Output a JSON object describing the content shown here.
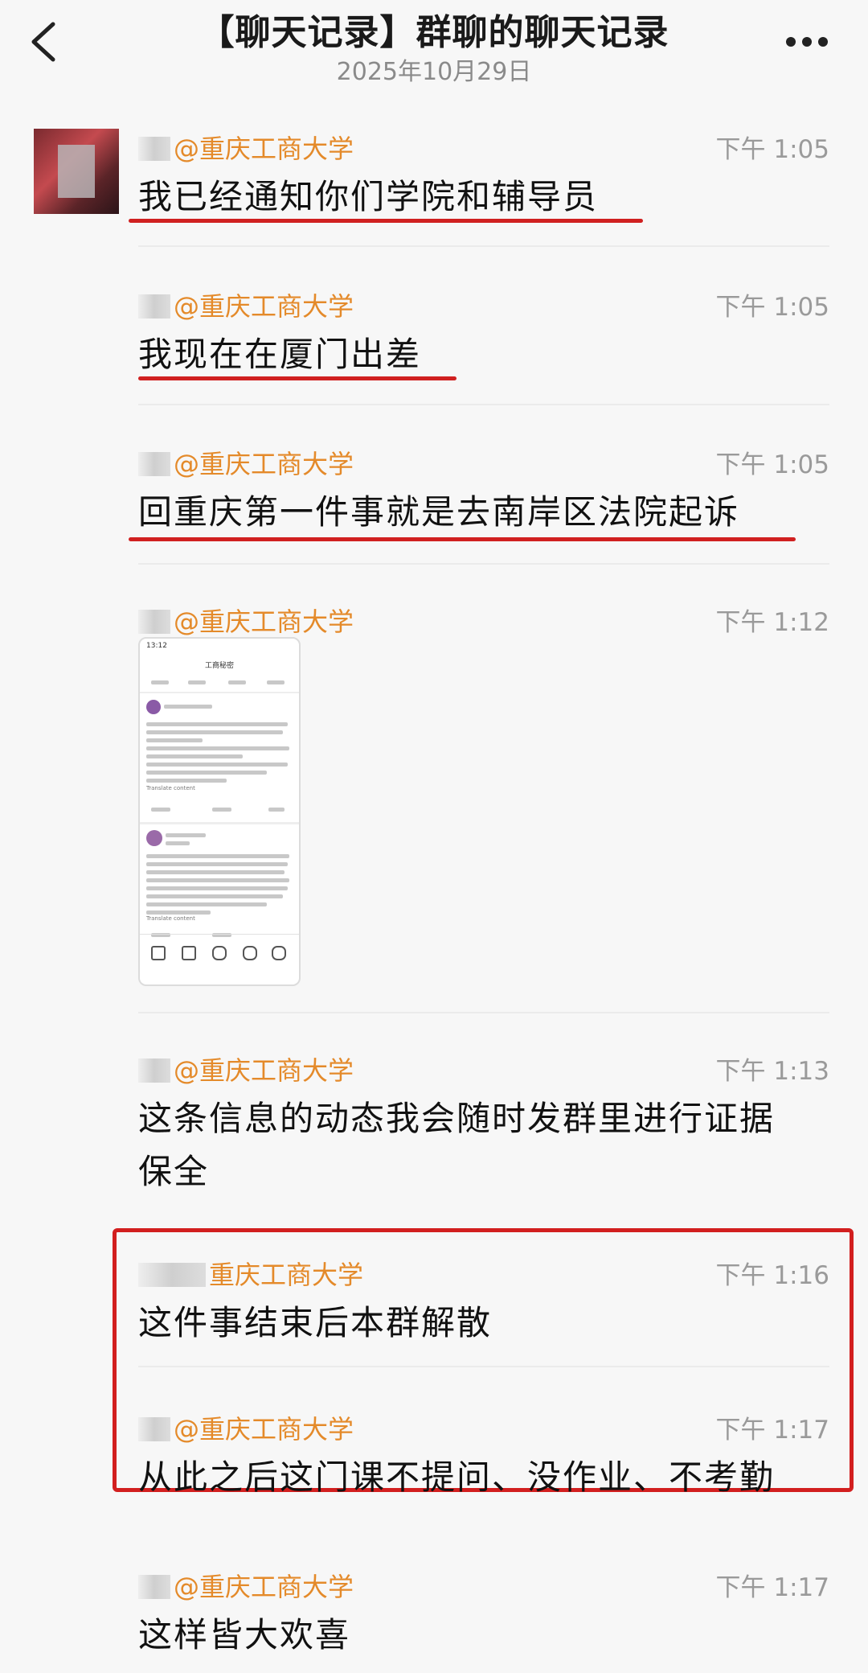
{
  "header": {
    "title": "【聊天记录】群聊的聊天记录",
    "date": "2025年10月29日"
  },
  "messages": [
    {
      "sender": "@重庆工商大学",
      "time": "下午 1:05",
      "text": "我已经通知你们学院和辅导员",
      "underlined": true
    },
    {
      "sender": "@重庆工商大学",
      "time": "下午 1:05",
      "text": "我现在在厦门出差",
      "underlined": true
    },
    {
      "sender": "@重庆工商大学",
      "time": "下午 1:05",
      "text": "回重庆第一件事就是去南岸区法院起诉",
      "underlined": true
    },
    {
      "sender": "@重庆工商大学",
      "time": "下午 1:12",
      "image": "phone-screenshot"
    },
    {
      "sender": "@重庆工商大学",
      "time": "下午 1:13",
      "text": "这条信息的动态我会随时发群里进行证据保全"
    },
    {
      "sender": "重庆工商大学",
      "time": "下午 1:16",
      "text": "这件事结束后本群解散",
      "highlighted": true
    },
    {
      "sender": "@重庆工商大学",
      "time": "下午 1:17",
      "text": "从此之后这门课不提问、没作业、不考勤",
      "highlighted": true
    },
    {
      "sender": "@重庆工商大学",
      "time": "下午 1:17",
      "text": "这样皆大欢喜"
    }
  ],
  "screenshot": {
    "time": "13:12",
    "title": "工商秘密",
    "translate_1": "Translate content",
    "translate_2": "Translate content"
  },
  "colors": {
    "sender": "#e48a2a",
    "highlight": "#d21f1f",
    "time": "#9a9a9a"
  },
  "icons": [
    "back-icon",
    "more-icon"
  ]
}
